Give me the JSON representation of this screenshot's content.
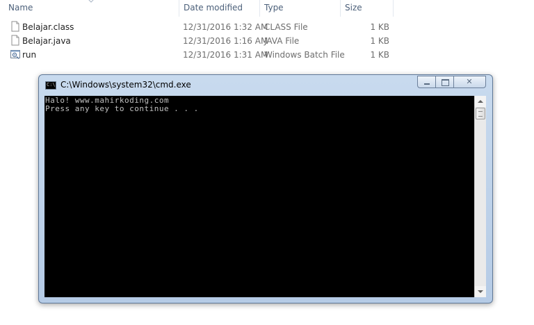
{
  "explorer": {
    "columns": {
      "name": "Name",
      "date_modified": "Date modified",
      "type": "Type",
      "size": "Size"
    },
    "files": [
      {
        "name": "Belajar.class",
        "date": "12/31/2016 1:32 AM",
        "type": "CLASS File",
        "size": "1 KB",
        "icon": "blank-file-icon"
      },
      {
        "name": "Belajar.java",
        "date": "12/31/2016 1:16 AM",
        "type": "JAVA File",
        "size": "1 KB",
        "icon": "blank-file-icon"
      },
      {
        "name": "run",
        "date": "12/31/2016 1:31 AM",
        "type": "Windows Batch File",
        "size": "1 KB",
        "icon": "batch-file-icon"
      }
    ]
  },
  "cmd": {
    "title": "C:\\Windows\\system32\\cmd.exe",
    "icon_text": "C:\\",
    "output_lines": [
      "Halo! www.mahirkoding.com",
      "Press any key to continue . . ."
    ],
    "close_glyph": "✕"
  },
  "colors": {
    "header_text": "#4c607a",
    "console_bg": "#000000",
    "console_text": "#c0c0c0",
    "window_frame": "#b5cbe6"
  }
}
